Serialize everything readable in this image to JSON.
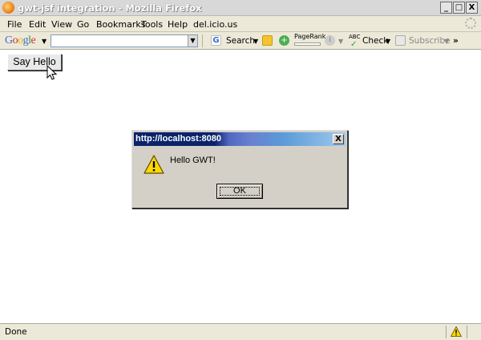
{
  "window": {
    "title": "gwt-jsf integration - Mozilla Firefox",
    "minimize": "_",
    "maximize": "□",
    "close": "X"
  },
  "menu": {
    "items": [
      "File",
      "Edit",
      "View",
      "Go",
      "Bookmarks",
      "Tools",
      "Help",
      "del.icio.us"
    ]
  },
  "toolbar": {
    "logo_letters": [
      "G",
      "o",
      "o",
      "g",
      "l",
      "e"
    ],
    "search_value": "",
    "search_label": "Search",
    "pagerank_label": "PageRank",
    "check_label": "Check",
    "check_icon_text": "ABC",
    "subscribe_label": "Subscribe",
    "more": "»"
  },
  "page": {
    "say_hello_label": "Say Hello"
  },
  "dialog": {
    "title": "http://localhost:8080",
    "close": "X",
    "message": "Hello GWT!",
    "ok_label": "OK"
  },
  "statusbar": {
    "text": "Done"
  },
  "colors": {
    "dialog_title_start": "#0a246a",
    "dialog_title_end": "#a0c8ec",
    "warning_yellow": "#ffd800"
  }
}
